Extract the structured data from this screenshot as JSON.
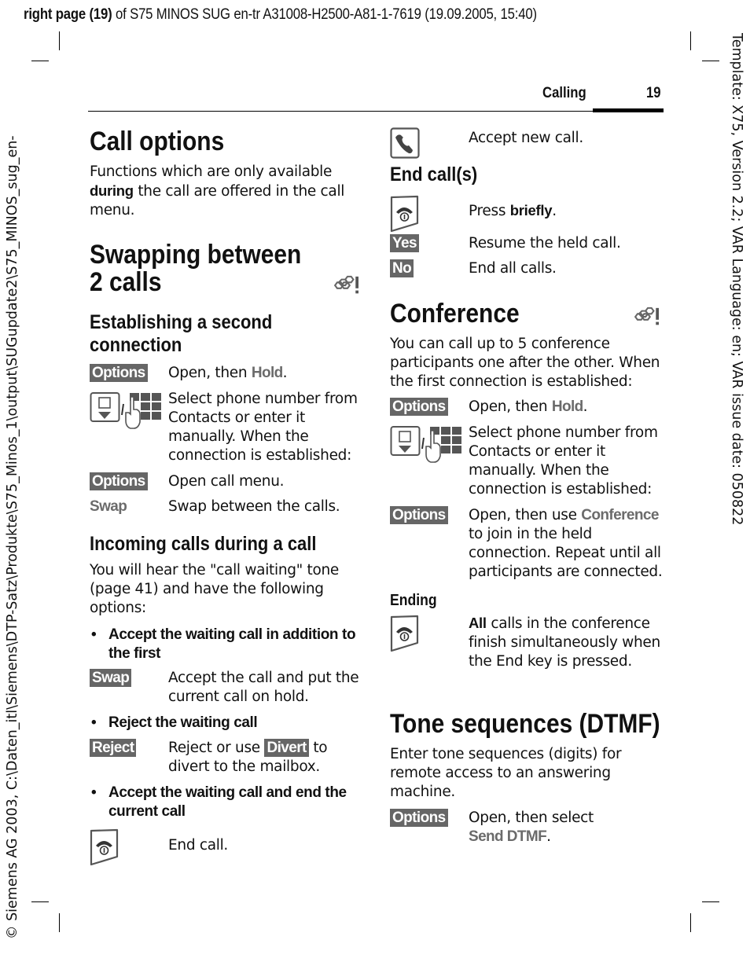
{
  "header": {
    "prefix_bold": "right page (19)",
    "rest": " of S75 MINOS SUG en-tr A31008-H2500-A81-1-7619 (19.09.2005, 15:40)"
  },
  "side_left": "© Siemens AG 2003, C:\\Daten_itl\\Siemens\\DTP-Satz\\Produkte\\S75_Minos_1\\output\\SUGupdate2\\S75_MINOS_sug_en-",
  "side_right": "Template: X75, Version 2.2; VAR Language: en; VAR issue date: 050822",
  "running_head": {
    "section": "Calling",
    "page": "19"
  },
  "left": {
    "call_options": {
      "title": "Call options",
      "body_pre": "Functions which are only available ",
      "body_bold": "during",
      "body_post": " the call are offered in the call menu."
    },
    "swapping": {
      "title_line1": "Swapping between",
      "title_line2": "2 calls",
      "icon": "network-service-icon"
    },
    "establishing": {
      "title_line1": "Establishing a second",
      "title_line2": "connection",
      "rows": [
        {
          "key": "Options",
          "text_pre": "Open, then ",
          "menu": "Hold",
          "text_post": "."
        },
        {
          "icon": "contacts-or-keypad-icon",
          "text": "Select phone number from Contacts or enter it manually. When the connection is established:"
        },
        {
          "key": "Options",
          "text": "Open call menu."
        },
        {
          "menu": "Swap",
          "text": "Swap between the calls."
        }
      ]
    },
    "incoming": {
      "title": "Incoming calls during a call",
      "body": "You will hear the \"call waiting\" tone (page 41) and have the following options:",
      "bullet1": "Accept the waiting call in addition to the first",
      "row1": {
        "key": "Swap",
        "text": "Accept the call and put the current call on hold."
      },
      "bullet2": "Reject the waiting call",
      "row2": {
        "key": "Reject",
        "text_pre": "Reject or use ",
        "key2": "Divert",
        "text_post": " to divert to the mailbox."
      },
      "bullet3": "Accept the waiting call and end the current call",
      "row3": {
        "icon": "end-key-icon",
        "text": "End call."
      }
    }
  },
  "right": {
    "accept_row": {
      "icon": "call-key-icon",
      "text": "Accept new call."
    },
    "end_calls": {
      "title": "End call(s)",
      "row1": {
        "icon": "end-key-icon",
        "text_pre": "Press ",
        "text_bold": "briefly",
        "text_post": "."
      },
      "row2": {
        "key": "Yes",
        "text": "Resume the held call."
      },
      "row3": {
        "key": "No",
        "text": "End all calls."
      }
    },
    "conference": {
      "title": "Conference",
      "icon": "network-service-icon",
      "body": "You can call up to 5 conference participants one after the other. When the first connection is established:",
      "row1": {
        "key": "Options",
        "text_pre": "Open, then ",
        "menu": "Hold",
        "text_post": "."
      },
      "row2": {
        "icon": "contacts-or-keypad-icon",
        "text": "Select phone number from Contacts or enter it manually. When the connection is established:"
      },
      "row3": {
        "key": "Options",
        "text_pre": "Open, then use ",
        "menu": "Conference",
        "text_post": " to join in the held connection. Repeat until all participants are connected."
      },
      "ending_title": "Ending",
      "row4": {
        "icon": "end-key-icon",
        "text_bold": "All",
        "text_post": " calls in the conference finish simultaneously when the End key is pressed."
      }
    },
    "dtmf": {
      "title": "Tone sequences (DTMF)",
      "body": "Enter tone sequences (digits) for remote access to an answering machine.",
      "row1": {
        "key": "Options",
        "text_pre": "Open, then select ",
        "menu": "Send DTMF",
        "text_post": "."
      }
    }
  },
  "colors": {
    "key_bg": "#666666",
    "menu_text": "#6b6b6b"
  }
}
